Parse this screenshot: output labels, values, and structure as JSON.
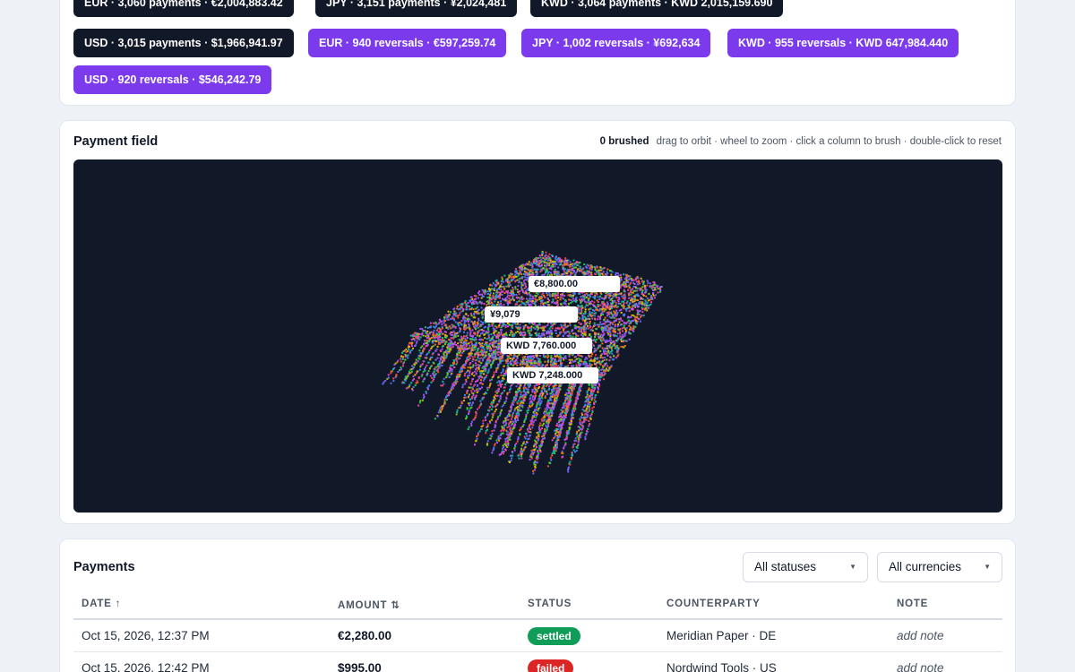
{
  "summary_chips": [
    {
      "label": "EUR · 3,060 payments · €2,004,883.42",
      "kind": "dark"
    },
    {
      "label": "JPY · 3,151 payments · ¥2,024,481",
      "kind": "dark"
    },
    {
      "label": "KWD · 3,064 payments · KWD 2,015,159.690",
      "kind": "dark"
    },
    {
      "label": "USD · 3,015 payments · $1,966,941.97",
      "kind": "dark"
    },
    {
      "label": "EUR · 940 reversals · €597,259.74",
      "kind": "violet"
    },
    {
      "label": "JPY · 1,002 reversals · ¥692,634",
      "kind": "violet"
    },
    {
      "label": "KWD · 955 reversals · KWD 647,984.440",
      "kind": "violet"
    },
    {
      "label": "USD · 920 reversals · $546,242.79",
      "kind": "violet"
    }
  ],
  "field": {
    "title": "Payment field",
    "brushed": "0 brushed",
    "hint": "drag to orbit · wheel to zoom · click a column to brush · double-click to reset",
    "tags": [
      "€8,800.00",
      "¥9,079",
      "KWD 7,760.000",
      "KWD 7,248.000"
    ],
    "palette": [
      "#ef4444",
      "#f97316",
      "#eab308",
      "#84cc16",
      "#22c55e",
      "#14b8a6",
      "#3b82f6",
      "#6366f1",
      "#a855f7",
      "#ec4899",
      "#8b5cf6",
      "#d946ef"
    ]
  },
  "payments": {
    "title": "Payments",
    "status_filter": "All statuses",
    "currency_filter": "All currencies",
    "columns": [
      "DATE ↑",
      "AMOUNT ⇅",
      "STATUS",
      "COUNTERPARTY",
      "NOTE"
    ],
    "rows": [
      {
        "date": "Oct 15, 2026, 12:37 PM",
        "amount": "€2,280.00",
        "status": "settled",
        "counterparty": "Meridian Paper · DE",
        "note": "add note"
      },
      {
        "date": "Oct 15, 2026, 12:42 PM",
        "amount": "$995.00",
        "status": "failed",
        "counterparty": "Nordwind Tools · US",
        "note": "add note"
      }
    ]
  }
}
